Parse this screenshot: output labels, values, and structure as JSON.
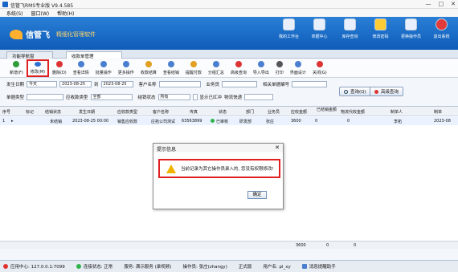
{
  "window": {
    "title": "信管飞RMS专业版 V9.4.585",
    "min": "—",
    "max": "□",
    "close": "✕"
  },
  "menu": [
    "系统(S)",
    "窗口(W)",
    "帮助(H)"
  ],
  "brand": {
    "name": "信管飞",
    "slogan": "精细化管理软件"
  },
  "nav": [
    {
      "label": "我的工作台",
      "icon": "monitor-icon"
    },
    {
      "label": "单据中心",
      "icon": "doc-center-icon"
    },
    {
      "label": "库存查询",
      "icon": "warehouse-icon"
    },
    {
      "label": "修改密码",
      "icon": "lock-icon"
    },
    {
      "label": "更换操作员",
      "icon": "user-switch-icon"
    },
    {
      "label": "退出系统",
      "icon": "exit-icon"
    }
  ],
  "tabs": [
    "功能导航窗",
    "收款单管理"
  ],
  "toolbar": [
    {
      "label": "新增(F)",
      "color": "#2e9d3a"
    },
    {
      "label": "修改(M)",
      "color": "#2f6fd1",
      "selected": true
    },
    {
      "label": "删除(D)",
      "color": "#d33"
    },
    {
      "label": "查看详情",
      "color": "#4a7fd0"
    },
    {
      "label": "批量操作",
      "color": "#4a7fd0"
    },
    {
      "label": "更多操作",
      "color": "#4a7fd0"
    },
    {
      "label": "收款结算",
      "color": "#e0a020"
    },
    {
      "label": "查看结销",
      "color": "#4a7fd0"
    },
    {
      "label": "提醒付款",
      "color": "#e0a020"
    },
    {
      "label": "分组汇总",
      "color": "#4a7fd0"
    },
    {
      "label": "高级查询",
      "color": "#d33"
    },
    {
      "label": "导入导出",
      "color": "#4a7fd0"
    },
    {
      "label": "打印",
      "color": "#555"
    },
    {
      "label": "界面设计",
      "color": "#4a7fd0"
    },
    {
      "label": "关闭(G)",
      "color": "#d33"
    }
  ],
  "filters": {
    "date_label": "发生日期",
    "date_mode": "今天",
    "date_from": "2023-08-25",
    "to": "到",
    "date_to": "2023-08-25",
    "customer_label": "客户名称",
    "customer_value": "",
    "clerk_label": "业务员",
    "clerk_value": "",
    "ref_label": "相关单据编号",
    "ref_value": "",
    "type_label": "单据类型",
    "type_value": "",
    "collect_type_label": "应收款类型",
    "collect_type_value": "全部",
    "settle_label": "结销状态",
    "settle_value": "所有",
    "show_redline": "显示已红冲",
    "logistics_label": "物流快递",
    "logistics_value": "",
    "query_btn": "查询(Q)",
    "adv_btn": "高级查询"
  },
  "columns": [
    "序号",
    "标记",
    "结销状态",
    "发生日期",
    "应收款类型",
    "客户名称",
    "传真",
    "状态",
    "部门",
    "业务员",
    "应收金额",
    "已结销金额",
    "物流代收金额",
    "制单人",
    "制单"
  ],
  "rows": [
    {
      "idx": "1",
      "flag": "",
      "settle": "未结销",
      "date": "2023-08-25 00:00",
      "type": "销售应收款",
      "customer": "庄拓公司测试",
      "fax": "63563899",
      "status": "已审核",
      "dept": "研发部",
      "clerk": "张庄",
      "amount": "3600",
      "settled": "0",
      "logistics": "0",
      "maker": "李拓",
      "maker_date": "2023-08"
    }
  ],
  "totals": {
    "amount": "3600",
    "settled": "0",
    "logistics": "0"
  },
  "status": {
    "app_center": "应用中心: 127.0.0.1:7099",
    "conn": "连接状态: 正常",
    "service": "服务: 满示服务 (录视频)",
    "operator": "操作员: 张庄(zhangy)",
    "edition": "正式版",
    "user": "用户名: pl_xy",
    "msg": "消息提醒助手"
  },
  "dialog": {
    "title": "提示信息",
    "close": "✕",
    "message": "当前记录为其它操作员录入的, 您没有权限修改!",
    "ok": "确定"
  }
}
